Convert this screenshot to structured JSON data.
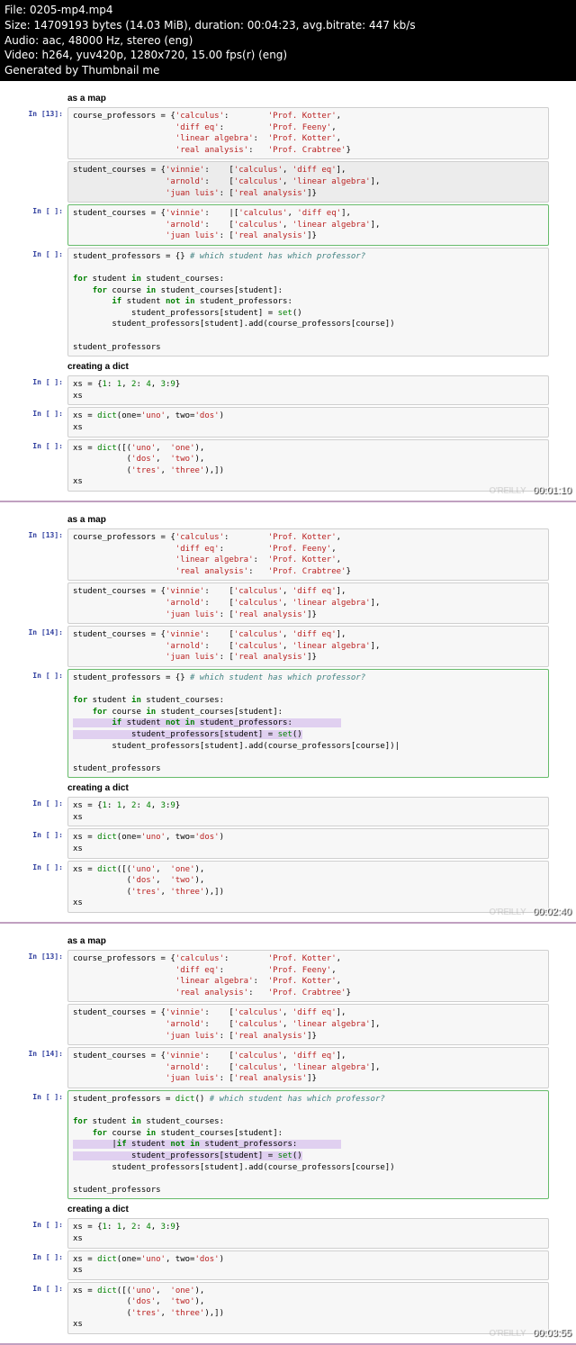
{
  "header": {
    "file": "File: 0205-mp4.mp4",
    "size": "Size: 14709193 bytes (14.03 MiB), duration: 00:04:23, avg.bitrate: 447 kb/s",
    "audio": "Audio: aac, 48000 Hz, stereo (eng)",
    "video": "Video: h264, yuv420p, 1280x720, 15.00 fps(r) (eng)",
    "gen": "Generated by Thumbnail me"
  },
  "section": {
    "asamap": "as a map",
    "creating": "creating a dict"
  },
  "prompts": {
    "in13": "In [13]:",
    "in14": "In [14]:",
    "inblank": "In [ ]:"
  },
  "code": {
    "course_prof": "course_professors = {'calculus':        'Prof. Kotter',\n                     'diff eq':         'Prof. Feeny',\n                     'linear algebra':  'Prof. Kotter',\n                     'real analysis':   'Prof. Crabtree'}",
    "student_courses": "student_courses = {'vinnie':    ['calculus', 'diff eq'],\n                   'arnold':    ['calculus', 'linear algebra'],\n                   'juan luis': ['real analysis']}",
    "student_courses_cursor": "student_courses = {'vinnie':    |['calculus', 'diff eq'],\n                   'arnold':    ['calculus', 'linear algebra'],\n                   'juan luis': ['real analysis']}",
    "sp_header": "student_professors = {} ",
    "sp_header_dict": "student_professors = dict() ",
    "sp_comment": "# which student has which professor?",
    "sp_body": "\nfor student in student_courses:\n    for course in student_courses[student]:\n        if student not in student_professors:\n            student_professors[student] = set()\n        student_professors[student].add(course_professors[course])\n\nstudent_professors",
    "xs1": "xs = {1: 1, 2: 4, 3:9}\nxs",
    "xs2": "xs = dict(one='uno', two='dos')\nxs",
    "xs3": "xs = dict([('uno',  'one'),\n           ('dos',  'two'),\n           ('tres', 'three'),])\nxs"
  },
  "timestamps": {
    "f1": "00:01:10",
    "f2": "00:02:40",
    "f3": "00:03:55"
  },
  "watermark": "O'REILLY"
}
